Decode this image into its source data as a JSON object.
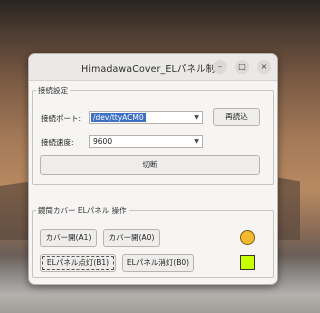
{
  "window": {
    "title": "HimadawaCover_ELパネル制御",
    "controls": {
      "minimize": "–",
      "maximize": "□",
      "close": "×"
    }
  },
  "connection": {
    "legend": "接続設定",
    "port_label": "接続ポート:",
    "port_value": "/dev/ttyACM0",
    "reload_button": "再読込",
    "speed_label": "接続速度:",
    "speed_value": "9600",
    "disconnect_button": "切断"
  },
  "control": {
    "legend": "鏡筒カバー ELパネル 操作",
    "cover_open": "カバー開(A1)",
    "cover_close": "カバー開(A0)",
    "el_on": "ELパネル点灯(B1)",
    "el_off": "ELパネル消灯(B0)",
    "cover_indicator_color": "#f5b92e",
    "el_indicator_color": "#c8ff00"
  }
}
